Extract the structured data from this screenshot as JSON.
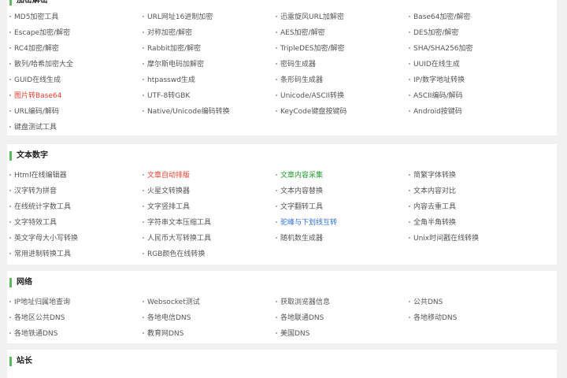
{
  "sections": [
    {
      "title": "加密解密",
      "items": [
        {
          "label": "MD5加密工具"
        },
        {
          "label": "URL网址16进制加密"
        },
        {
          "label": "迅雷旋风URL加解密"
        },
        {
          "label": "Base64加密/解密"
        },
        {
          "label": "Escape加密/解密"
        },
        {
          "label": "对称加密/解密"
        },
        {
          "label": "AES加密/解密"
        },
        {
          "label": "DES加密/解密"
        },
        {
          "label": "RC4加密/解密"
        },
        {
          "label": "Rabbit加密/解密"
        },
        {
          "label": "TripleDES加密/解密"
        },
        {
          "label": "SHA/SHA256加密"
        },
        {
          "label": "散列/哈希加密大全"
        },
        {
          "label": "摩尔斯电码加解密"
        },
        {
          "label": "密码生成器"
        },
        {
          "label": "UUID在线生成"
        },
        {
          "label": "GUID在线生成"
        },
        {
          "label": "htpasswd生成"
        },
        {
          "label": "条形码生成器"
        },
        {
          "label": "IP/数字地址转换"
        },
        {
          "label": "图片转Base64",
          "style": "red"
        },
        {
          "label": "UTF-8转GBK"
        },
        {
          "label": "Unicode/ASCII转换"
        },
        {
          "label": "ASCII编码/解码"
        },
        {
          "label": "URL编码/解码"
        },
        {
          "label": "Native/Unicode编码转换"
        },
        {
          "label": "KeyCode键盘按键码"
        },
        {
          "label": "Android按键码"
        },
        {
          "label": "键盘测试工具"
        }
      ]
    },
    {
      "title": "文本数字",
      "items": [
        {
          "label": "Html在线编辑器"
        },
        {
          "label": "文章自动排版",
          "style": "red"
        },
        {
          "label": "文章内容采集",
          "style": "green"
        },
        {
          "label": "简繁字体转换"
        },
        {
          "label": "汉字转为拼音"
        },
        {
          "label": "火星文转换器"
        },
        {
          "label": "文本内容替换"
        },
        {
          "label": "文本内容对比"
        },
        {
          "label": "在线统计字数工具"
        },
        {
          "label": "文字竖排工具"
        },
        {
          "label": "文字翻转工具"
        },
        {
          "label": "内容去重工具"
        },
        {
          "label": "文字特效工具"
        },
        {
          "label": "字符串文本压缩工具"
        },
        {
          "label": "驼峰与下划线互转",
          "style": "blue"
        },
        {
          "label": "全角半角转换"
        },
        {
          "label": "英文字母大小写转换"
        },
        {
          "label": "人民币大写转换工具"
        },
        {
          "label": "随机数生成器"
        },
        {
          "label": "Unix时间戳在线转换"
        },
        {
          "label": "常用进制转换工具"
        },
        {
          "label": "RGB颜色在线转换"
        }
      ]
    },
    {
      "title": "网络",
      "items": [
        {
          "label": "IP地址归属地查询"
        },
        {
          "label": "Websocket测试"
        },
        {
          "label": "获取浏览器信息"
        },
        {
          "label": "公共DNS"
        },
        {
          "label": "各地区公共DNS"
        },
        {
          "label": "各地电信DNS"
        },
        {
          "label": "各地联通DNS"
        },
        {
          "label": "各地移动DNS"
        },
        {
          "label": "各地铁通DNS"
        },
        {
          "label": "教育网DNS"
        },
        {
          "label": "美国DNS"
        }
      ]
    },
    {
      "title": "站长",
      "items": []
    }
  ]
}
